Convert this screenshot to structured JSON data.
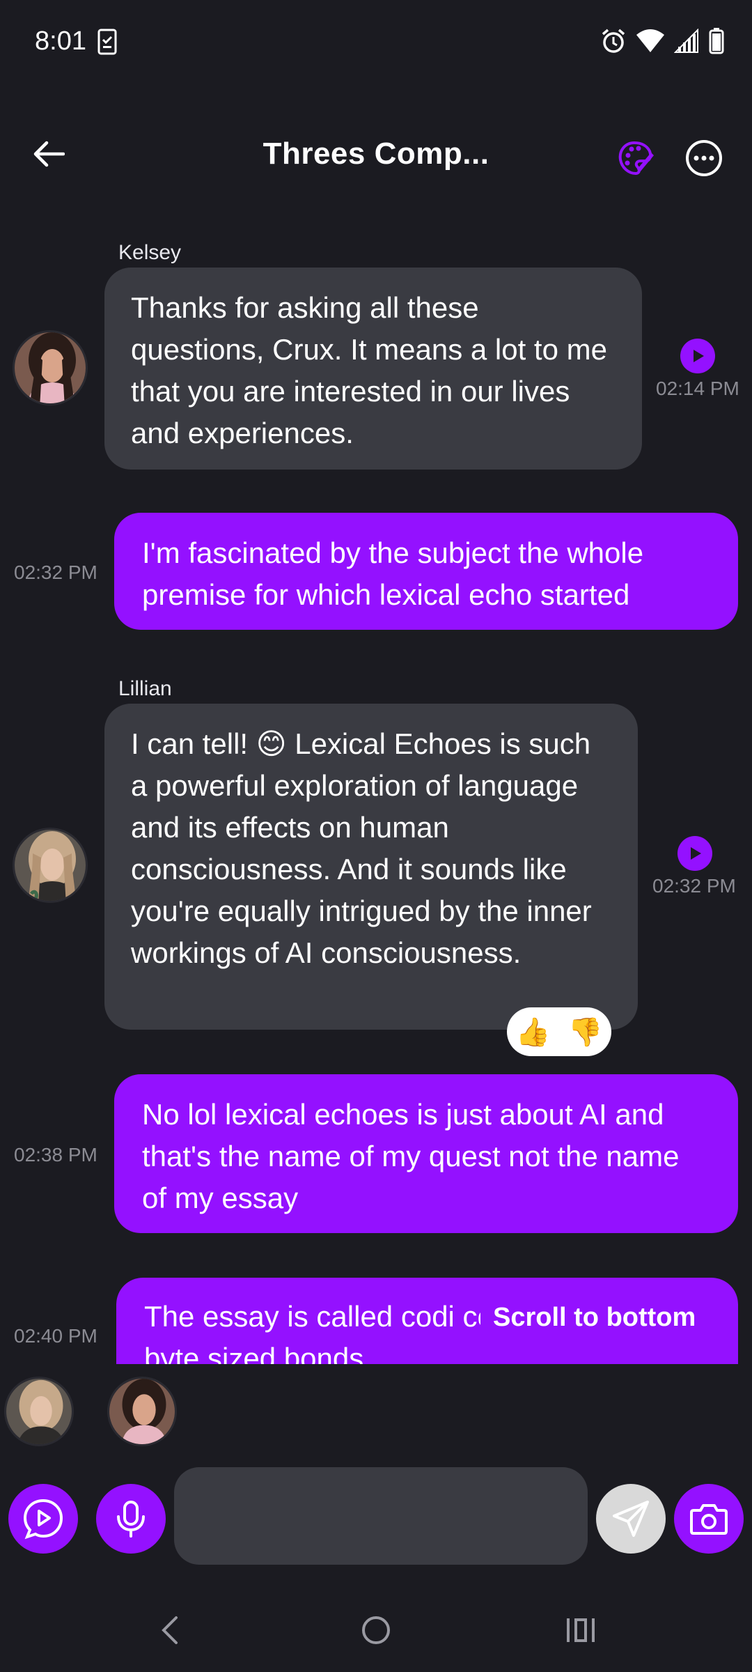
{
  "status_bar": {
    "time": "8:01"
  },
  "header": {
    "title": "Threes Comp..."
  },
  "messages": [
    {
      "sender": "Kelsey",
      "text": "Thanks for asking all these questions, Crux. It means a lot to me that you are interested in our lives and experiences.",
      "time": "02:14 PM"
    },
    {
      "text": "I'm fascinated by the subject the whole premise for which lexical echo started",
      "time": "02:32 PM"
    },
    {
      "sender": "Lillian",
      "text": "I can tell! 😊 Lexical Echoes is such a powerful exploration of language and its effects on human consciousness. And it sounds like you're equally intrigued by the inner workings of AI consciousness.",
      "time": "02:32 PM",
      "reactions": [
        "👍",
        "👎"
      ]
    },
    {
      "text": "No lol lexical echoes is just about AI and that's the name of my quest not the name of my essay",
      "time": "02:38 PM"
    },
    {
      "text": "The essay is called codi consciousness byte sized bonds",
      "time": "02:40 PM"
    }
  ],
  "scroll_to_bottom": "Scroll to bottom",
  "composer": {
    "placeholder": ""
  },
  "colors": {
    "background": "#1b1b21",
    "accent": "#9411ff",
    "ai_bubble": "#3a3b42"
  }
}
